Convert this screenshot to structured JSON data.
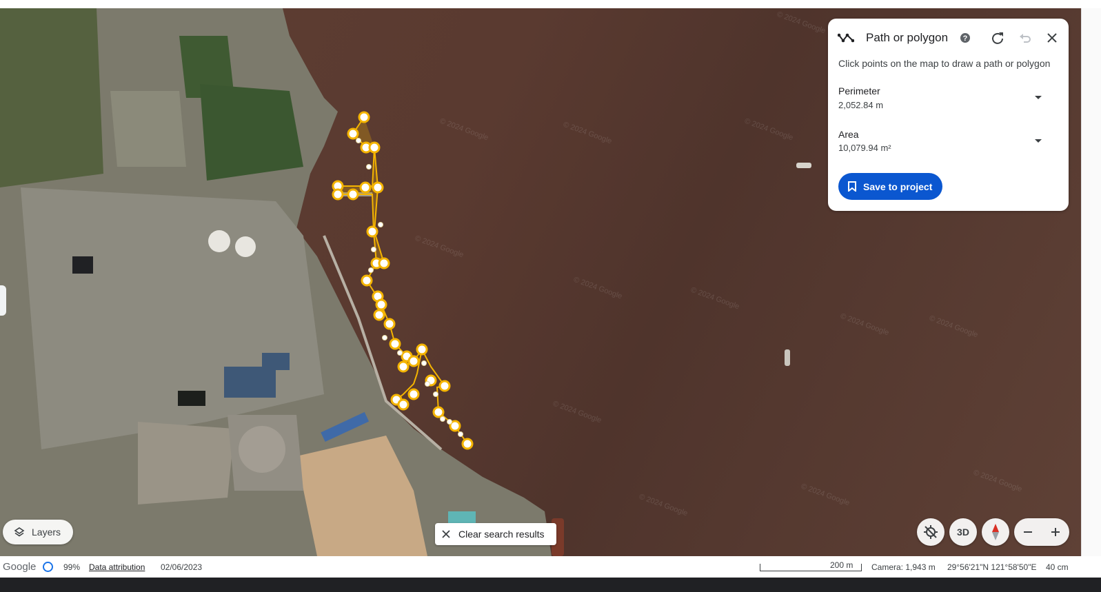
{
  "panel": {
    "title": "Path or polygon",
    "hint": "Click points on the map to draw a path or polygon",
    "perimeter_label": "Perimeter",
    "perimeter_value": "2,052.84 m",
    "area_label": "Area",
    "area_value": "10,079.94 m²",
    "save_label": "Save to project",
    "icons": [
      "path-tool-icon",
      "help-icon",
      "redo-icon",
      "undo-icon",
      "close-icon"
    ]
  },
  "map": {
    "watermark": "© 2024 Google",
    "layers_label": "Layers",
    "clear_label": "Clear search results",
    "view_3d_label": "3D",
    "path_color": "#f4b400"
  },
  "footer": {
    "logo": "Google",
    "load_percent": "99%",
    "attribution": "Data attribution",
    "date": "02/06/2023",
    "scale": "200 m",
    "camera": "Camera: 1,943 m",
    "coords": "29°56'21\"N 121°58'50\"E",
    "elevation": "40 cm"
  },
  "colors": {
    "accent": "#0b57d0",
    "water": "#5a3a30"
  }
}
